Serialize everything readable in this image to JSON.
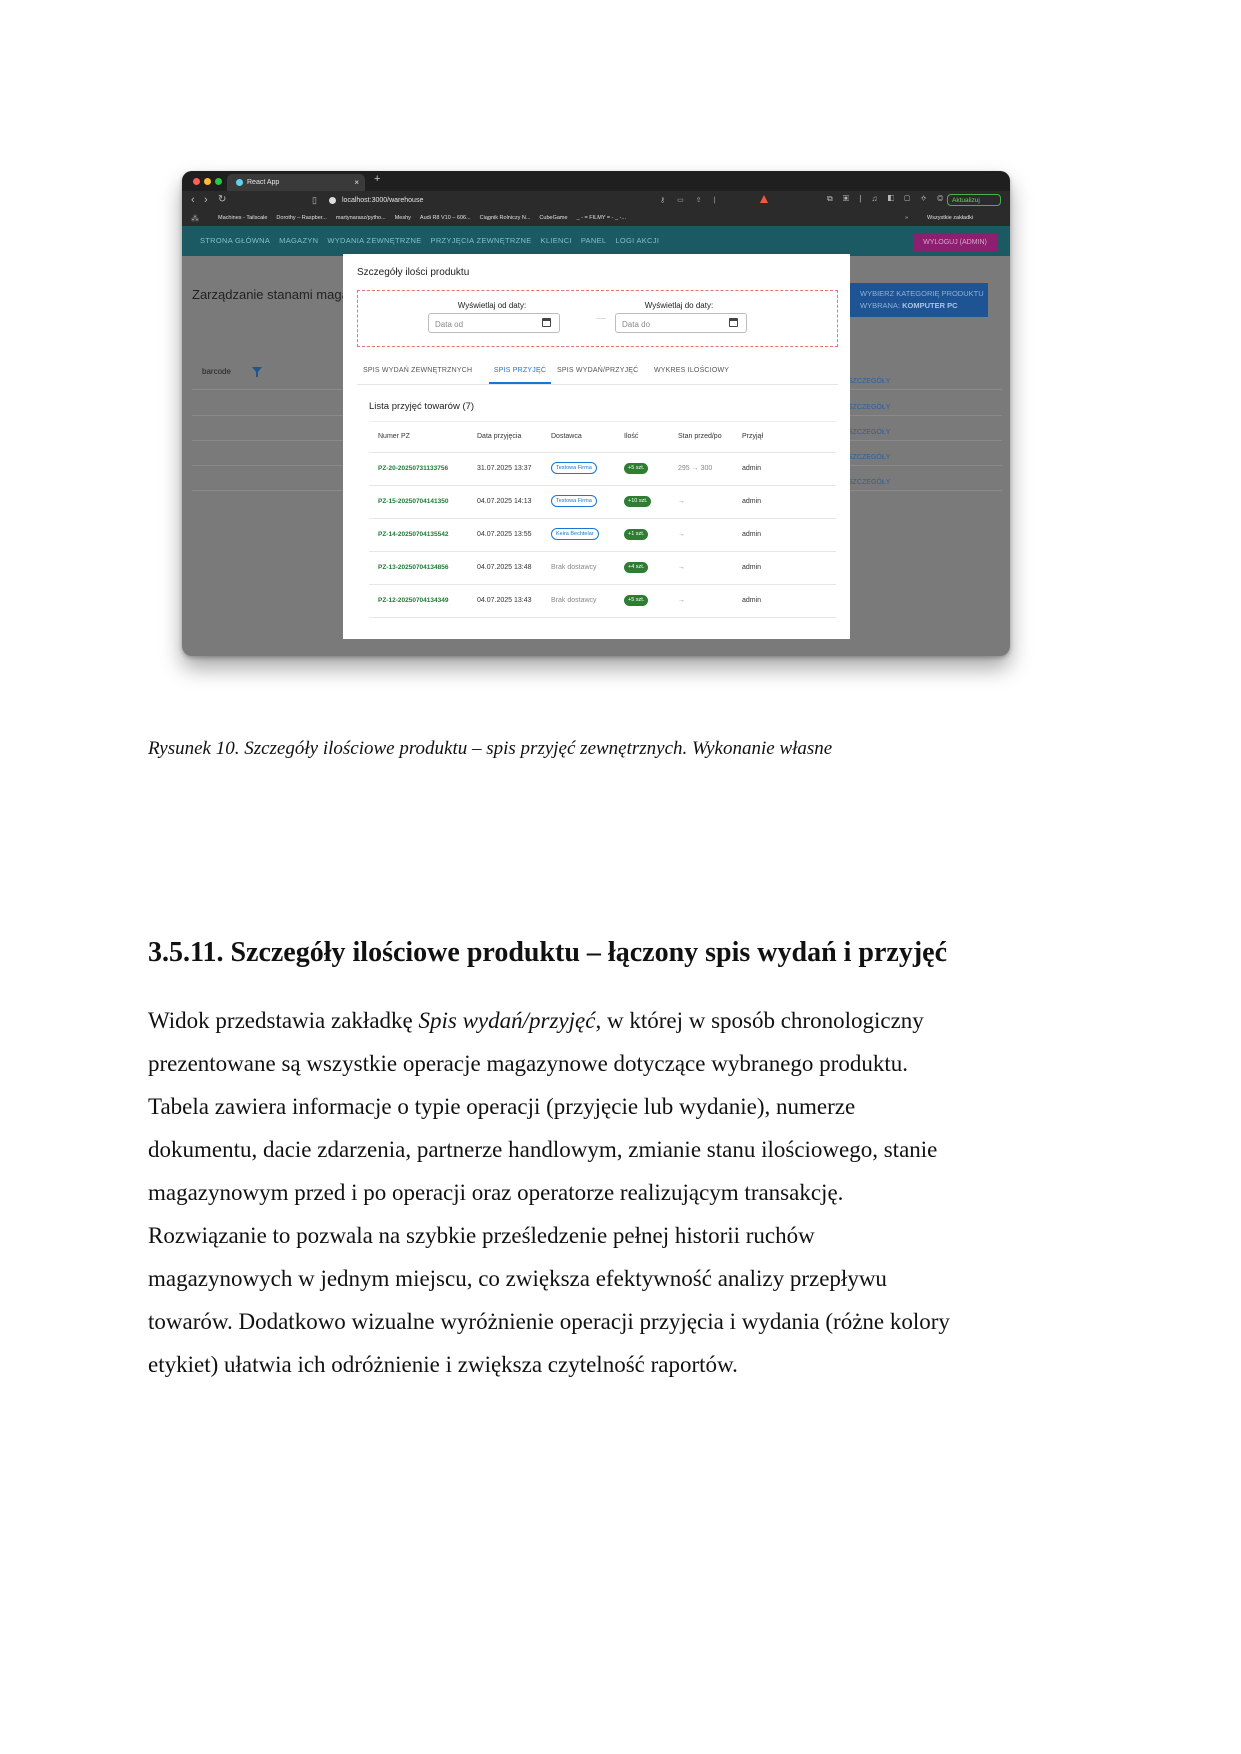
{
  "browser": {
    "tab_title": "React App",
    "tab_close": "×",
    "new_tab": "+",
    "url": "localhost:3000/warehouse",
    "update_button": "Aktualizuj",
    "bookmarks": [
      "Machines - Tailscale",
      "Dorothy – Raspber...",
      "martynarasz/pytho...",
      "Meshy",
      "Audi R8 V10 – 606...",
      "Ciągnik Rolniczy N...",
      "CubeGame",
      "_ - = FILMY = - _ -..."
    ],
    "bookmarks_more": "»",
    "all_bookmarks": "Wszystkie zakładki"
  },
  "app": {
    "nav_links": [
      "STRONA GŁÓWNA",
      "MAGAZYN",
      "WYDANIA ZEWNĘTRZNE",
      "PRZYJĘCIA ZEWNĘTRZNE",
      "KLIENCI",
      "PANEL",
      "LOGI AKCJI"
    ],
    "logout": "WYLOGUJ (ADMIN)",
    "page_title": "Zarządzanie stanami magazynowymi",
    "category_button_line1": "WYBIERZ KATEGORIĘ PRODUKTU",
    "category_button_prefix": "WYBRANA: ",
    "category_button_value": "KOMPUTER PC",
    "barcode_label": "barcode",
    "details_label": "SZCZEGÓŁY"
  },
  "modal": {
    "title": "Szczegóły ilości produktu",
    "date_from_label": "Wyświetlaj od daty:",
    "date_from_placeholder": "Data od",
    "date_to_label": "Wyświetlaj do daty:",
    "date_to_placeholder": "Data do",
    "tabs": [
      "SPIS WYDAŃ ZEWNĘTRZNYCH",
      "SPIS PRZYJĘĆ",
      "SPIS WYDAŃ/PRZYJĘĆ",
      "WYKRES ILOŚCIOWY"
    ],
    "active_tab": "SPIS PRZYJĘĆ",
    "list_title": "Lista przyjęć towarów (7)",
    "columns": [
      "Numer PZ",
      "Data przyjęcia",
      "Dostawca",
      "Ilość",
      "Stan przed/po",
      "Przyjął"
    ],
    "rows": [
      {
        "pz": "PZ-20-20250731133756",
        "date": "31.07.2025 13:37",
        "supplier": "Testowa Firma",
        "supplier_chip": true,
        "qty": "+5 szt.",
        "stock": "295 → 300",
        "by": "admin"
      },
      {
        "pz": "PZ-15-20250704141350",
        "date": "04.07.2025 14:13",
        "supplier": "Testowa Firma",
        "supplier_chip": true,
        "qty": "+10 szt.",
        "stock": "→",
        "by": "admin"
      },
      {
        "pz": "PZ-14-20250704135542",
        "date": "04.07.2025 13:55",
        "supplier": "Keira Bechtelar",
        "supplier_chip": true,
        "qty": "+1 szt.",
        "stock": "→",
        "by": "admin"
      },
      {
        "pz": "PZ-13-20250704134856",
        "date": "04.07.2025 13:48",
        "supplier": "Brak dostawcy",
        "supplier_chip": false,
        "qty": "+4 szt.",
        "stock": "→",
        "by": "admin"
      },
      {
        "pz": "PZ-12-20250704134349",
        "date": "04.07.2025 13:43",
        "supplier": "Brak dostawcy",
        "supplier_chip": false,
        "qty": "+5 szt.",
        "stock": "→",
        "by": "admin"
      }
    ]
  },
  "document": {
    "caption": "Rysunek 10. Szczegóły ilościowe produktu – spis przyjęć zewnętrznych. Wykonanie własne",
    "heading": "3.5.11. Szczegóły ilościowe produktu – łączony spis wydań i przyjęć",
    "paragraph_lines": [
      {
        "before": "Widok przedstawia zakładkę ",
        "italic": "Spis wydań/przyjęć",
        "after": ", w której w sposób chronologiczny"
      },
      {
        "before": "prezentowane są wszystkie operacje magazynowe dotyczące wybranego produktu.",
        "italic": "",
        "after": ""
      },
      {
        "before": "Tabela zawiera informacje o typie operacji (przyjęcie lub wydanie), numerze",
        "italic": "",
        "after": ""
      },
      {
        "before": "dokumentu, dacie zdarzenia, partnerze handlowym, zmianie stanu ilościowego, stanie",
        "italic": "",
        "after": ""
      },
      {
        "before": "magazynowym przed i po operacji oraz operatorze realizującym transakcję.",
        "italic": "",
        "after": ""
      },
      {
        "before": "Rozwiązanie to pozwala na szybkie prześledzenie pełnej historii ruchów",
        "italic": "",
        "after": ""
      },
      {
        "before": "magazynowych w jednym miejscu, co zwiększa efektywność analizy przepływu",
        "italic": "",
        "after": ""
      },
      {
        "before": "towarów. Dodatkowo wizualne wyróżnienie operacji przyjęcia i wydania (różne kolory",
        "italic": "",
        "after": ""
      },
      {
        "before": "etykiet) ułatwia ich odróżnienie i zwiększa czytelność raportów.",
        "italic": "",
        "after": ""
      }
    ]
  }
}
